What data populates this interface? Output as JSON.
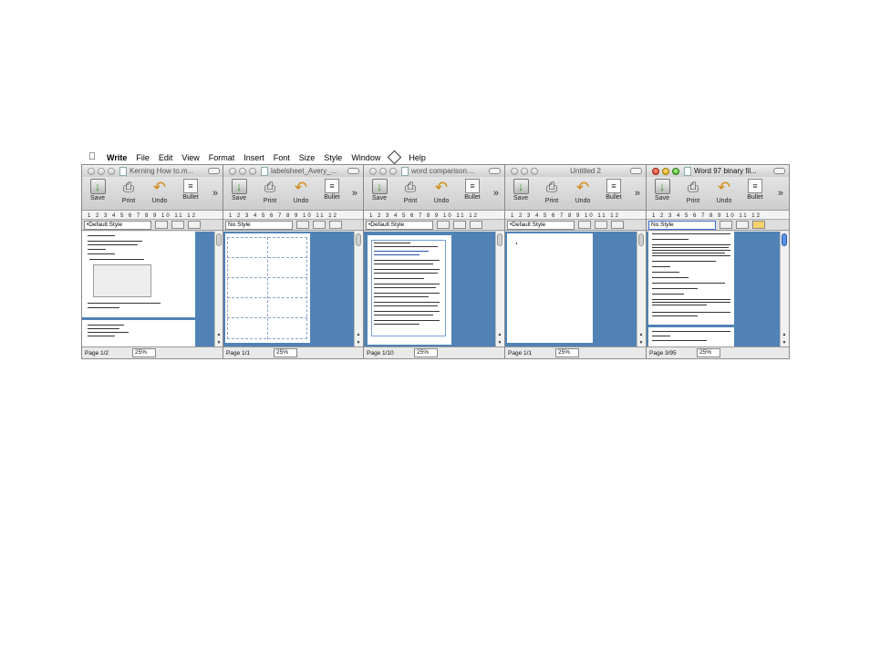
{
  "menubar": {
    "apple_icon": "apple-icon",
    "app": "Write",
    "items": [
      "File",
      "Edit",
      "View",
      "Format",
      "Insert",
      "Font",
      "Size",
      "Style",
      "Window"
    ],
    "script_icon": "script-menu-icon",
    "help": "Help"
  },
  "toolbar": {
    "save": "Save",
    "print": "Print",
    "undo": "Undo",
    "bullet": "Bullet",
    "more": "»"
  },
  "ruler_text": "1 2 3 4 5 6 7 8 9 10 11 12",
  "windows": [
    {
      "title": "Kerning How to.m...",
      "style": "•Default Style",
      "page": "Page 1/2",
      "zoom": "25%",
      "active": false
    },
    {
      "title": "labelsheet_Avery_...",
      "style": "No Style",
      "page": "Page 1/1",
      "zoom": "25%",
      "active": false
    },
    {
      "title": "word comparison....",
      "style": "•Default Style",
      "page": "Page 1/10",
      "zoom": "25%",
      "active": false
    },
    {
      "title": "Untitled 2",
      "style": "•Default Style",
      "page": "Page 1/1",
      "zoom": "25%",
      "active": false
    },
    {
      "title": "Word 97 binary fil...",
      "style": "No Style",
      "page": "Page 3/95",
      "zoom": "25%",
      "active": true
    }
  ],
  "colors": {
    "document_background": "#5082b6",
    "close_red": "#d22b15",
    "minimize_yellow": "#d9a200",
    "zoom_green": "#3aa51a"
  }
}
